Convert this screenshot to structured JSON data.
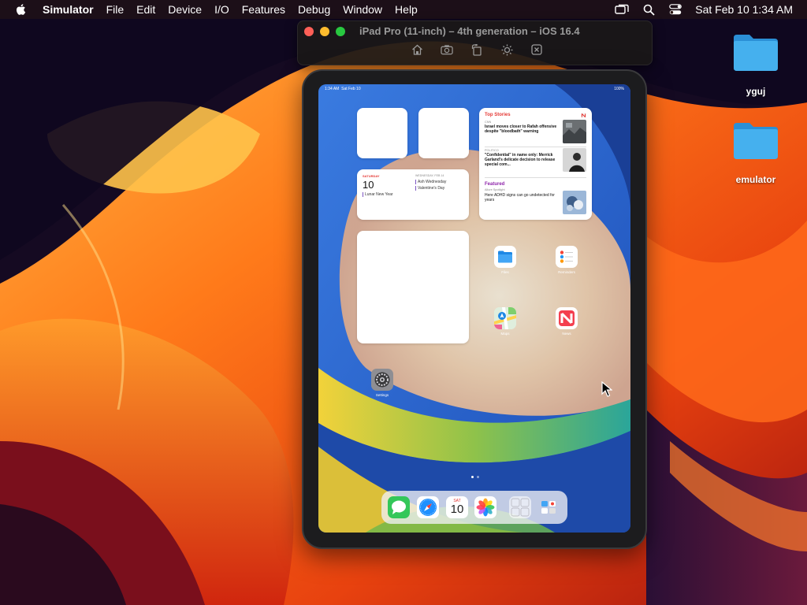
{
  "menubar": {
    "app_name": "Simulator",
    "items": [
      "File",
      "Edit",
      "Device",
      "I/O",
      "Features",
      "Debug",
      "Window",
      "Help"
    ],
    "clock": "Sat Feb 10  1:34 AM",
    "status_icons": [
      "screen-mirroring-icon",
      "search-icon",
      "control-center-icon"
    ]
  },
  "simulator": {
    "title": "iPad Pro (11-inch) – 4th generation – iOS 16.4",
    "tools": [
      "home-icon",
      "screenshot-icon",
      "rotate-icon",
      "appearance-icon",
      "close-app-icon"
    ]
  },
  "desktop": {
    "folders": [
      {
        "name": "yguj",
        "color": "#3aa5e6"
      },
      {
        "name": "emulator",
        "color": "#3aa5e6"
      }
    ]
  },
  "ipad": {
    "status_time": "1:34 AM",
    "status_date": "Sat Feb 10",
    "battery": "100%",
    "calendar_widget": {
      "day_label": "SATURDAY",
      "date": "10",
      "event": "Lunar New Year",
      "next_label": "WEDNESDAY, FEB 14",
      "next_events": [
        "Ash Wednesday",
        "Valentine's Day"
      ]
    },
    "news_widget": {
      "header": "Top Stories",
      "stories": [
        {
          "source": "CNN",
          "headline": "Israel moves closer to Rafah offensive despite \"bloodbath\" warning"
        },
        {
          "source": "POLITICO",
          "headline": "\"Confidential\" in name only: Merrick Garland's delicate decision to release special com..."
        }
      ],
      "featured_header": "Featured",
      "featured_source": "Allure Spotlight",
      "featured_headline": "Here ADHD signs can go undetected for years"
    },
    "apps": [
      {
        "label": "Files",
        "icon": "files-icon"
      },
      {
        "label": "Reminders",
        "icon": "reminders-icon"
      },
      {
        "label": "Maps",
        "icon": "maps-icon"
      },
      {
        "label": "News",
        "icon": "news-icon"
      },
      {
        "label": "Settings",
        "icon": "settings-icon"
      }
    ],
    "page_count": 2,
    "active_page": 1,
    "dock": {
      "apps": [
        "Messages",
        "Safari",
        "Calendar",
        "Photos",
        "App Library",
        "Recent Apps"
      ],
      "calendar_day": "SAT",
      "calendar_date": "10"
    }
  },
  "colors": {
    "menubar_bg": "#2a1612",
    "folder_blue": "#3aa5e6",
    "close": "#fe5f57",
    "minimize": "#febc2e",
    "zoom": "#28c840",
    "news_red": "#e53935",
    "featured_purple": "#8e24aa"
  }
}
